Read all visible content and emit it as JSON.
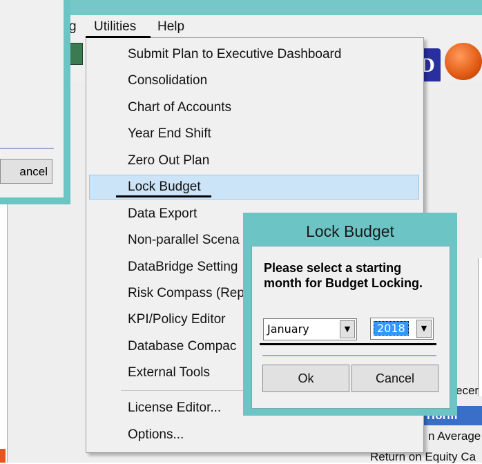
{
  "menubar": {
    "partial_left": "g",
    "utilities": "Utilities",
    "help": "Help"
  },
  "left_dialog": {
    "cancel_label": "ancel"
  },
  "toolbar": {
    "d_icon": "D"
  },
  "menu": {
    "items": [
      "Submit Plan to Executive Dashboard",
      "Consolidation",
      "Chart of Accounts",
      "Year End Shift",
      "Zero Out Plan",
      "Lock Budget",
      "Data Export",
      "Non-parallel Scena",
      "DataBridge Setting",
      "Risk Compass (Rep",
      "KPI/Policy Editor",
      "Database Compac",
      "External Tools",
      "License Editor...",
      "Options..."
    ],
    "highlighted": "Lock Budget"
  },
  "right_panel": {
    "partial_1": "ecer",
    "perf_label": "rform",
    "partial_2": "n Average",
    "partial_3": "Return on Equity Ca"
  },
  "dialog": {
    "title": "Lock Budget",
    "prompt": "Please select a starting month for Budget Locking.",
    "month_value": "January",
    "year_value": "2018",
    "ok_label": "Ok",
    "cancel_label": "Cancel"
  },
  "colors": {
    "dialog_frame": "#6cc4c4",
    "menu_highlight": "#cce4f7",
    "selection": "#3399ff"
  }
}
